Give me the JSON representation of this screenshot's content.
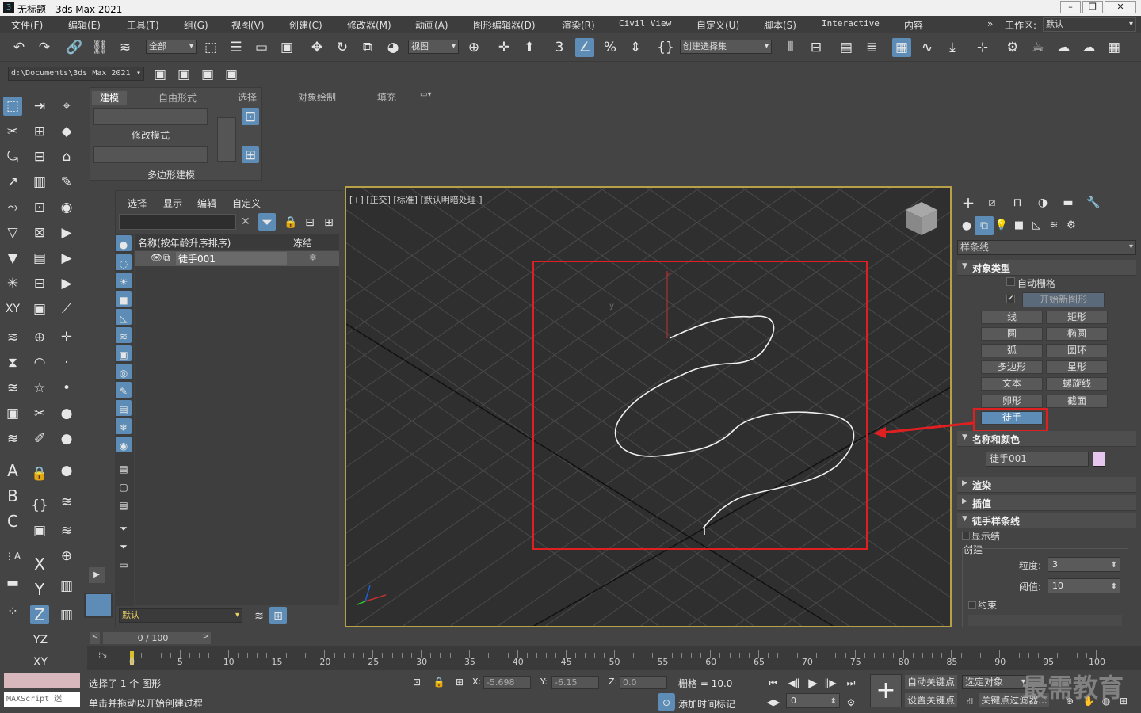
{
  "window": {
    "title": "无标题 - 3ds Max 2021"
  },
  "menu": {
    "items": [
      "文件(F)",
      "编辑(E)",
      "工具(T)",
      "组(G)",
      "视图(V)",
      "创建(C)",
      "修改器(M)",
      "动画(A)",
      "图形编辑器(D)",
      "渲染(R)",
      "Civil View",
      "自定义(U)",
      "脚本(S)",
      "Interactive",
      "内容"
    ],
    "workspace_label": "工作区:",
    "workspace_value": "默认"
  },
  "toolbar": {
    "selection_filter": "全部",
    "ref_coord": "视图",
    "named_selection": "创建选择集",
    "project_path": "d:\\Documents\\3ds Max 2021"
  },
  "ribbon": {
    "tabs": [
      "建模",
      "自由形式",
      "选择",
      "对象绘制",
      "填充"
    ],
    "group_modify": "修改模式",
    "group_poly": "多边形建模"
  },
  "explorer": {
    "menu": [
      "选择",
      "显示",
      "编辑",
      "自定义"
    ],
    "col_name": "名称(按年龄升序排序)",
    "col_freeze": "冻结",
    "row_name": "徒手001",
    "layer_value": "默认"
  },
  "viewport": {
    "label": "[+] [正交] [标准] [默认明暗处理 ]",
    "axis_z": "z",
    "axis_y": "y"
  },
  "command_panel": {
    "category": "样条线",
    "rollout_object_type": "对象类型",
    "auto_grid": "自动栅格",
    "start_new_shape": "开始新图形",
    "buttons": [
      "线",
      "矩形",
      "圆",
      "椭圆",
      "弧",
      "圆环",
      "多边形",
      "星形",
      "文本",
      "螺旋线",
      "卵形",
      "截面",
      "徒手"
    ],
    "rollout_name_color": "名称和颜色",
    "object_name": "徒手001",
    "object_color": "#e6c6ef",
    "rollout_render": "渲染",
    "rollout_interp": "插值",
    "rollout_freehand": "徒手样条线",
    "show_knots": "显示结",
    "create_group": "创建",
    "granularity_label": "粒度:",
    "granularity_value": "3",
    "threshold_label": "阈值:",
    "threshold_value": "10",
    "constrain": "约束"
  },
  "timeline": {
    "frame_display": "0 / 100",
    "ticks": [
      "0",
      "5",
      "10",
      "15",
      "20",
      "25",
      "30",
      "35",
      "40",
      "45",
      "50",
      "55",
      "60",
      "65",
      "70",
      "75",
      "80",
      "85",
      "90",
      "95",
      "100"
    ]
  },
  "status": {
    "maxscript": "MAXScript 迷",
    "selected": "选择了 1 个 图形",
    "prompt": "单击并拖动以开始创建过程",
    "x_label": "X:",
    "x_value": "-5.698",
    "y_label": "Y:",
    "y_value": "-6.15",
    "z_label": "Z:",
    "z_value": "0.0",
    "grid": "栅格 = 10.0",
    "add_time_tag": "添加时间标记",
    "auto_key": "自动关键点",
    "selected_obj": "选定对象",
    "set_key": "设置关键点",
    "key_filter": "关键点过滤器...",
    "frame_field": "0",
    "watermark": "最需教育"
  },
  "colors": {
    "accent_blue": "#5d8db6",
    "highlight_red": "#e02020",
    "viewport_border": "#b8a048"
  }
}
